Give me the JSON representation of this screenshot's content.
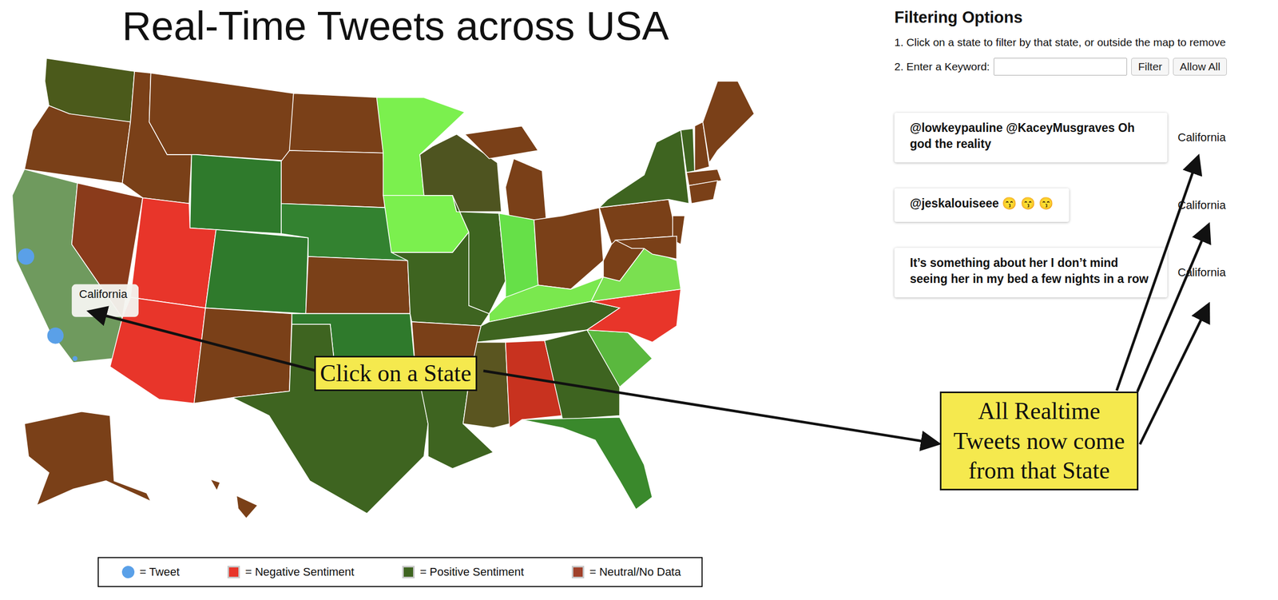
{
  "title": "Real-Time Tweets across USA",
  "map": {
    "regions": [
      {
        "color": "#4b5a1b"
      },
      {
        "color": "#7a4018"
      },
      {
        "color": "#6f9a5e"
      },
      {
        "color": "#8a3b1b"
      },
      {
        "color": "#7a4018"
      },
      {
        "color": "#7a4018"
      },
      {
        "color": "#2f7a2c"
      },
      {
        "color": "#e8352a"
      },
      {
        "color": "#e8352a"
      },
      {
        "color": "#2f7a2c"
      },
      {
        "color": "#7a4018"
      },
      {
        "color": "#7a4018"
      },
      {
        "color": "#7a4018"
      },
      {
        "color": "#338230"
      },
      {
        "color": "#7a4018"
      },
      {
        "color": "#2f7a2c"
      },
      {
        "color": "#3e6420"
      },
      {
        "color": "#7bf04e"
      },
      {
        "color": "#7bf04e"
      },
      {
        "color": "#3e6420"
      },
      {
        "color": "#7a4018"
      },
      {
        "color": "#3e6420"
      },
      {
        "color": "#4e5420"
      },
      {
        "color": "#3e6420"
      },
      {
        "color": "#7a4018"
      },
      {
        "color": "#66e048"
      },
      {
        "color": "#7a4018"
      },
      {
        "color": "#7ae84e"
      },
      {
        "color": "#3e6420"
      },
      {
        "color": "#5a5520"
      },
      {
        "color": "#c8321f"
      },
      {
        "color": "#3e6420"
      },
      {
        "color": "#3a892c"
      },
      {
        "color": "#5ab83e"
      },
      {
        "color": "#e8352a"
      },
      {
        "color": "#7ae050"
      },
      {
        "color": "#7a4018"
      },
      {
        "color": "#7a4018"
      },
      {
        "color": "#3e6420"
      },
      {
        "color": "#7a4018"
      },
      {
        "color": "#7a4018"
      },
      {
        "color": "#3e6420"
      },
      {
        "color": "#7a4018"
      },
      {
        "color": "#7a4018"
      },
      {
        "color": "#7a4018"
      },
      {
        "color": "#7a4018"
      },
      {
        "color": "#7a4018"
      },
      {
        "color": "#7a4018"
      }
    ],
    "pins": [
      {
        "kind": "large"
      },
      {
        "kind": "large"
      },
      {
        "kind": "small"
      }
    ],
    "tooltip": "California"
  },
  "legend": [
    {
      "kind": "dot",
      "color": "#5aa0e8",
      "label": "= Tweet"
    },
    {
      "kind": "swatch",
      "color": "#e8352a",
      "label": "= Negative Sentiment"
    },
    {
      "kind": "swatch",
      "color": "#3e6420",
      "label": "= Positive Sentiment"
    },
    {
      "kind": "swatch",
      "color": "#a0402a",
      "label": "= Neutral/No Data"
    }
  ],
  "filter": {
    "heading": "Filtering Options",
    "instruction": "1. Click on a state to filter by that state, or outside the map to remove",
    "keyword_label": "2. Enter a Keyword:",
    "keyword_value": "",
    "buttons": [
      "Filter",
      "Allow All"
    ]
  },
  "tweets": [
    {
      "text": "@lowkeypauline @KaceyMusgraves Oh god the reality",
      "state": "California"
    },
    {
      "text": "@jeskalouiseee 😙 😙 😙",
      "state": "California"
    },
    {
      "text": "It’s something about her I don’t mind seeing her in my bed a few nights in a row",
      "state": "California"
    }
  ],
  "annotations": [
    {
      "text": "Click on a State"
    },
    {
      "text": "All Realtime Tweets now come from that State"
    }
  ]
}
